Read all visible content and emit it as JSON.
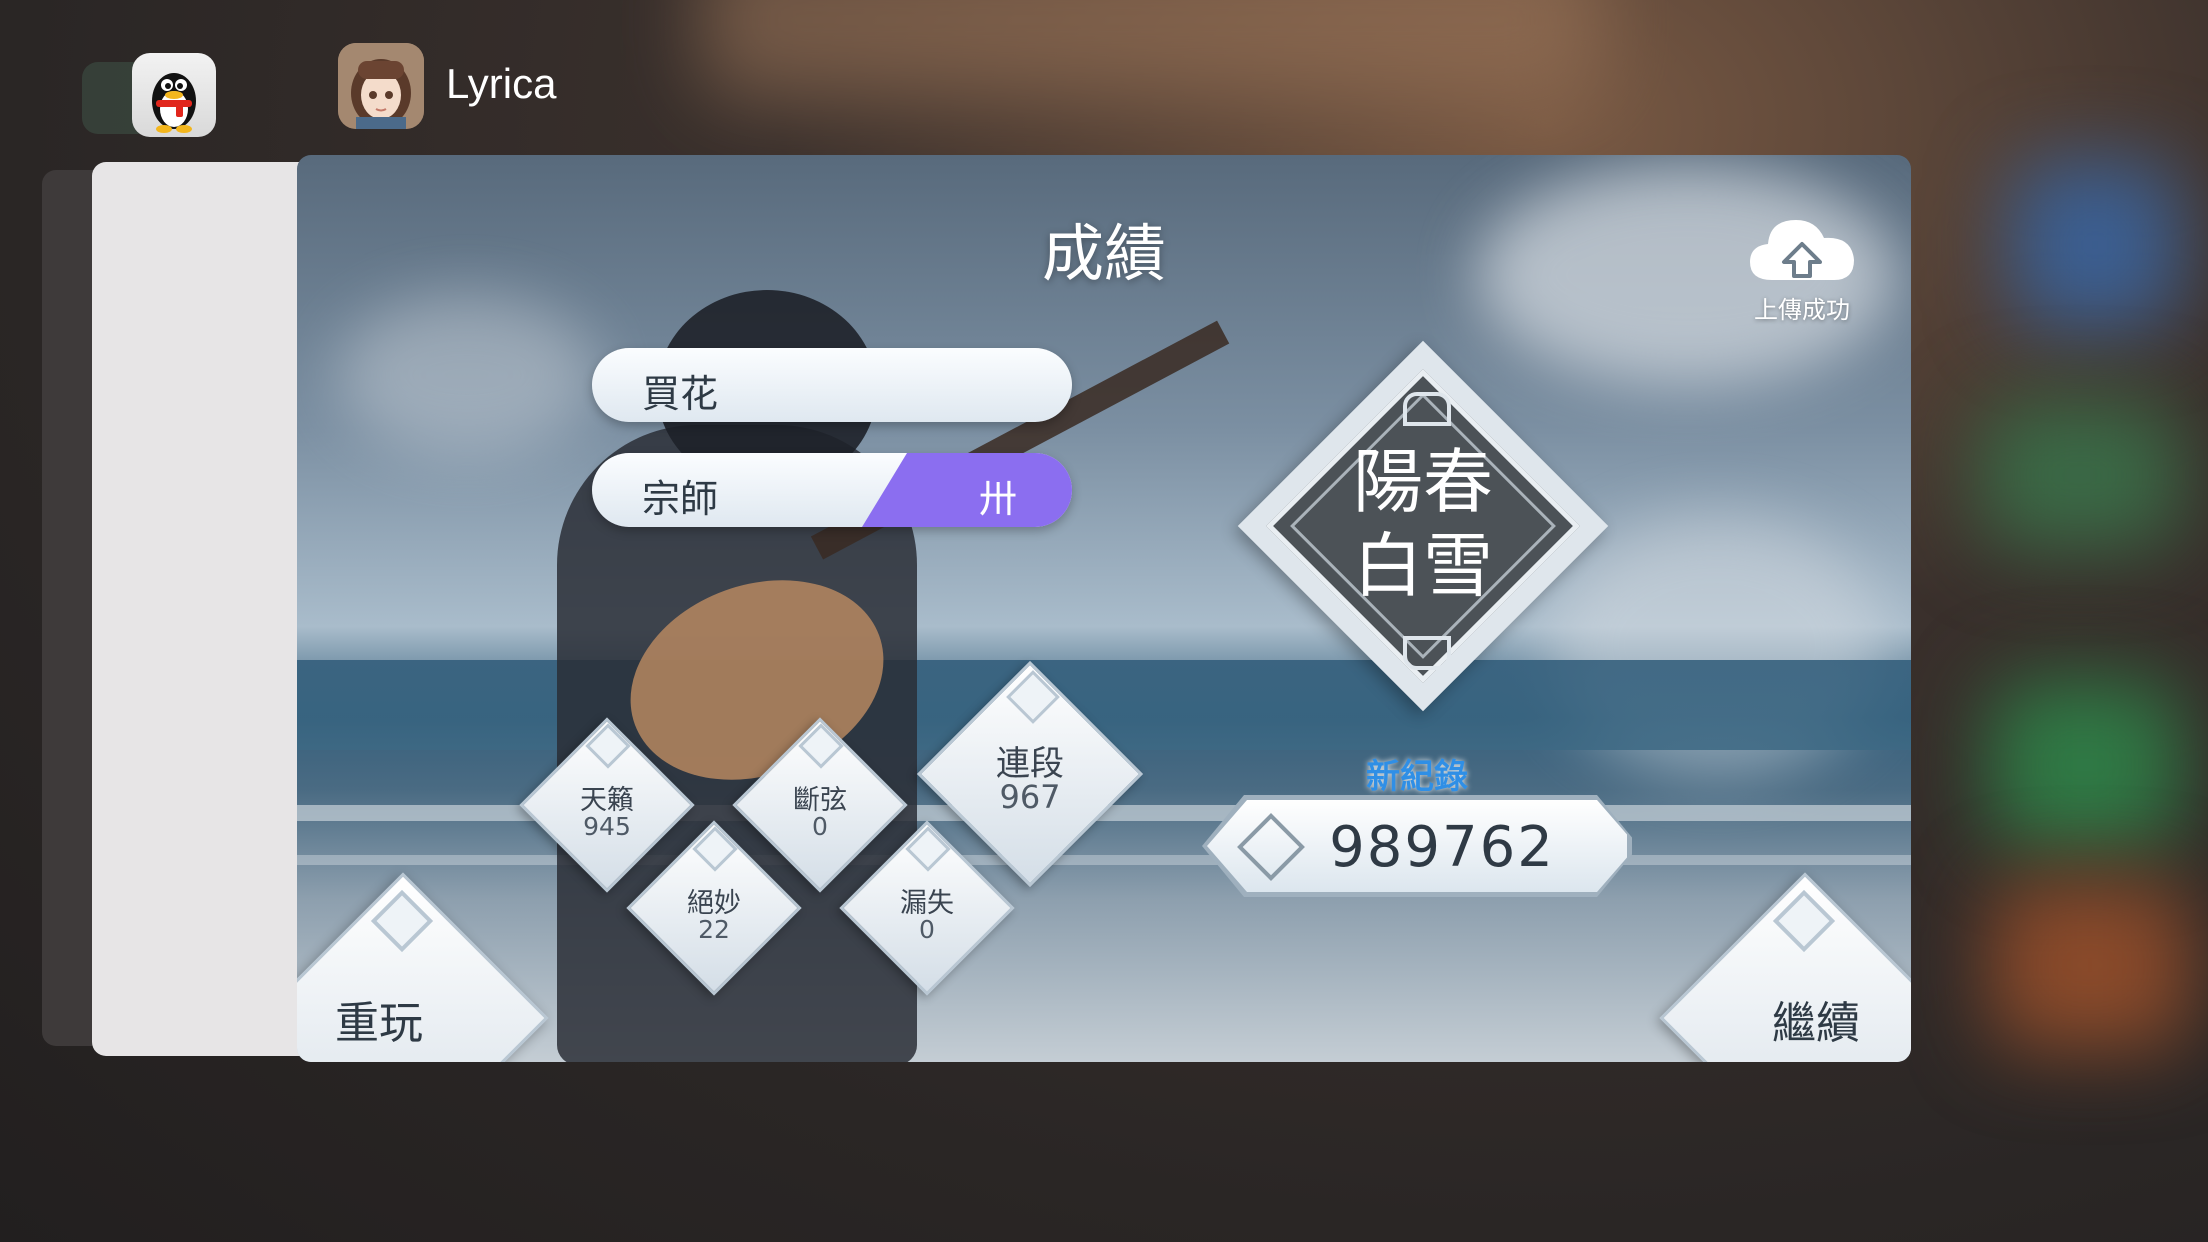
{
  "switcher": {
    "apps": [
      {
        "name_icon": "qq-penguin-icon"
      },
      {
        "title": "Lyrica",
        "icon": "lyrica-girl-icon"
      }
    ]
  },
  "game": {
    "title": "成績",
    "upload_status": "上傳成功",
    "song_title": "買花",
    "difficulty_name": "宗師",
    "difficulty_level": "卅",
    "grade_line1": "陽春",
    "grade_line2": "白雪",
    "new_record_label": "新紀錄",
    "score": "989762",
    "stats": {
      "perfect": {
        "label": "天籟",
        "value": "945"
      },
      "great": {
        "label": "絕妙",
        "value": "22"
      },
      "bad": {
        "label": "斷弦",
        "value": "0"
      },
      "miss": {
        "label": "漏失",
        "value": "0"
      },
      "combo": {
        "label": "連段",
        "value": "967"
      }
    },
    "replay_label": "重玩",
    "continue_label": "繼續"
  },
  "colors": {
    "difficulty_accent": "#8b6ef0",
    "new_record": "#2f8fe6"
  }
}
